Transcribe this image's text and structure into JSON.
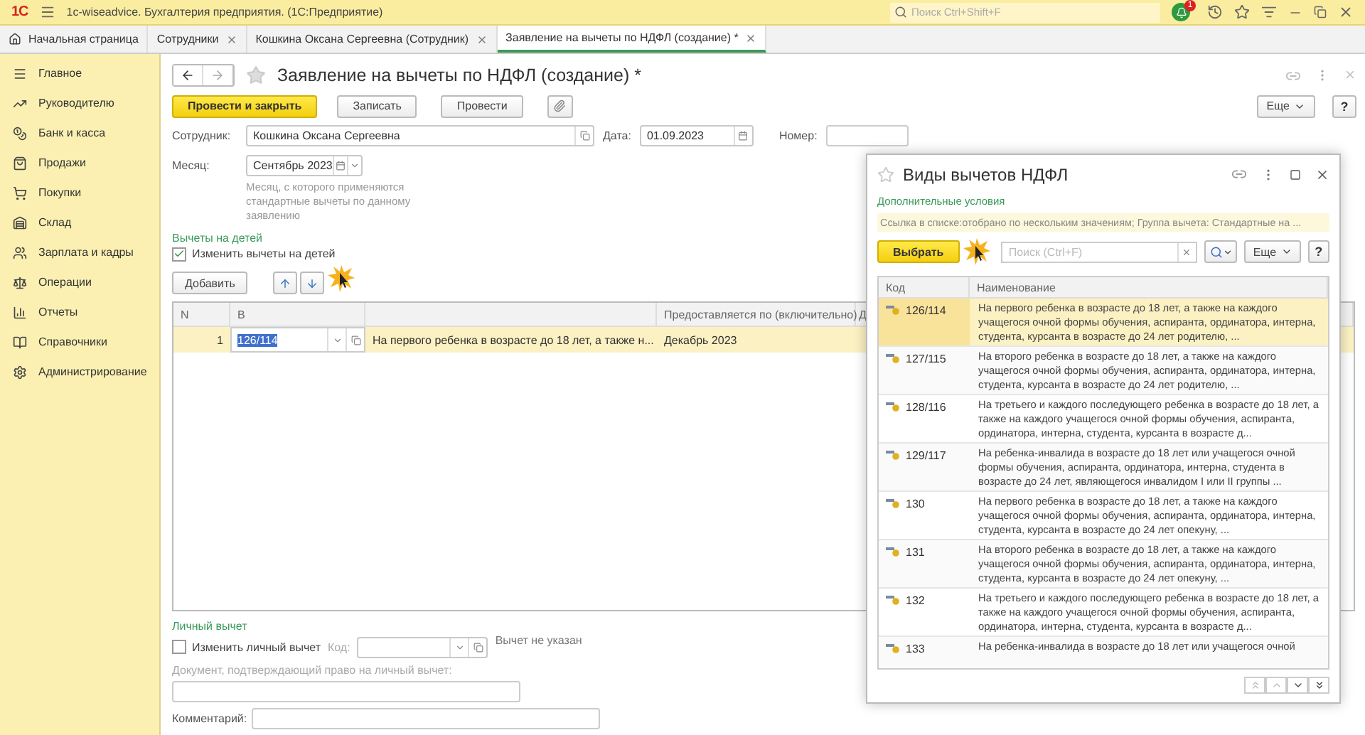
{
  "app": {
    "logo": "1С",
    "title": "1c-wiseadvice. Бухгалтерия предприятия.  (1С:Предприятие)",
    "search_placeholder": "Поиск Ctrl+Shift+F",
    "notifications": "1"
  },
  "tabs": [
    {
      "label": "Начальная страница",
      "selected": false,
      "closable": false
    },
    {
      "label": "Сотрудники",
      "selected": false,
      "closable": true
    },
    {
      "label": "Кошкина Оксана Сергеевна (Сотрудник)",
      "selected": false,
      "closable": true
    },
    {
      "label": "Заявление на вычеты по НДФЛ (создание) *",
      "selected": true,
      "closable": true
    }
  ],
  "sidebar": {
    "items": [
      {
        "label": "Главное"
      },
      {
        "label": "Руководителю"
      },
      {
        "label": "Банк и касса"
      },
      {
        "label": "Продажи"
      },
      {
        "label": "Покупки"
      },
      {
        "label": "Склад"
      },
      {
        "label": "Зарплата и кадры"
      },
      {
        "label": "Операции"
      },
      {
        "label": "Отчеты"
      },
      {
        "label": "Справочники"
      },
      {
        "label": "Администрирование"
      }
    ]
  },
  "form": {
    "title": "Заявление на вычеты по НДФЛ (создание) *",
    "buttons": [
      {
        "label": "Провести и закрыть",
        "kind": "primary"
      },
      {
        "label": "Записать",
        "kind": "plain"
      },
      {
        "label": "Провести",
        "kind": "plain"
      }
    ],
    "more_button": "Еще",
    "help_button": "?",
    "employee_label": "Сотрудник:",
    "employee": "Кошкина Оксана Сергеевна",
    "date_label": "Дата:",
    "date": "01.09.2023",
    "number_label": "Номер:",
    "month_label": "Месяц:",
    "month": "Сентябрь 2023",
    "month_hint": "Месяц, с которого применяются стандартные вычеты по данному заявлению",
    "children_section": "Вычеты на детей",
    "change_children": {
      "label": "Изменить вычеты на детей",
      "checked": true
    },
    "add_button": "Добавить",
    "table": {
      "columns": [
        "N",
        "В",
        "",
        "Предоставляется по (включительно)",
        "Д"
      ],
      "rows": [
        {
          "n": "1",
          "code": "126/114",
          "name": "На первого ребенка в возрасте до 18 лет, а также н...",
          "until": "Декабрь 2023",
          "selected": true
        }
      ]
    },
    "personal_section": "Личный вычет",
    "change_personal": {
      "label": "Изменить личный вычет",
      "checked": false
    },
    "code_label": "Код:",
    "personal_status": "Вычет не указан",
    "doc_label": "Документ, подтверждающий право на личный вычет:",
    "comment_label": "Комментарий:"
  },
  "popup": {
    "title": "Виды вычетов НДФЛ",
    "conditions_link": "Дополнительные условия",
    "filter": "Ссылка в списке:отобрано по нескольким значениям; Группа вычета: Стандартные на ...",
    "select_button": "Выбрать",
    "search_placeholder": "Поиск (Ctrl+F)",
    "more_button": "Еще",
    "help_button": "?",
    "columns": [
      "Код",
      "Наименование"
    ],
    "rows": [
      {
        "code": "126/114",
        "name": "На первого ребенка в возрасте до 18 лет, а также на каждого учащегося очной формы обучения, аспиранта, ординатора, интерна, студента, курсанта в возрасте до 24 лет родителю, ...",
        "selected": true
      },
      {
        "code": "127/115",
        "name": "На второго ребенка в возрасте до 18 лет, а также на каждого учащегося очной формы обучения, аспиранта, ординатора, интерна, студента, курсанта в возрасте до 24 лет родителю, ...",
        "selected": false
      },
      {
        "code": "128/116",
        "name": "На третьего и каждого последующего ребенка в возрасте до 18 лет, а также на каждого учащегося очной формы обучения, аспиранта, ординатора, интерна, студента, курсанта в возрасте д...",
        "selected": false
      },
      {
        "code": "129/117",
        "name": "На ребенка-инвалида в возрасте до 18 лет или учащегося очной формы обучения, аспиранта, ординатора, интерна, студента в возрасте до 24 лет, являющегося инвалидом I или II группы ...",
        "selected": false
      },
      {
        "code": "130",
        "name": "На первого ребенка в возрасте до 18 лет, а также на каждого учащегося очной формы обучения, аспиранта, ординатора, интерна, студента, курсанта в возрасте до 24 лет опекуну, ...",
        "selected": false
      },
      {
        "code": "131",
        "name": "На второго ребенка в возрасте до 18 лет, а также на каждого учащегося очной формы обучения, аспиранта, ординатора, интерна, студента, курсанта в возрасте до 24 лет опекуну, ...",
        "selected": false
      },
      {
        "code": "132",
        "name": "На третьего и каждого последующего ребенка в возрасте до 18 лет, а также на каждого учащегося очной формы обучения, аспиранта, ординатора, интерна, студента, курсанта в возрасте д...",
        "selected": false
      },
      {
        "code": "133",
        "name": "На ребенка-инвалида в возрасте до 18 лет или учащегося очной",
        "selected": false
      }
    ]
  }
}
